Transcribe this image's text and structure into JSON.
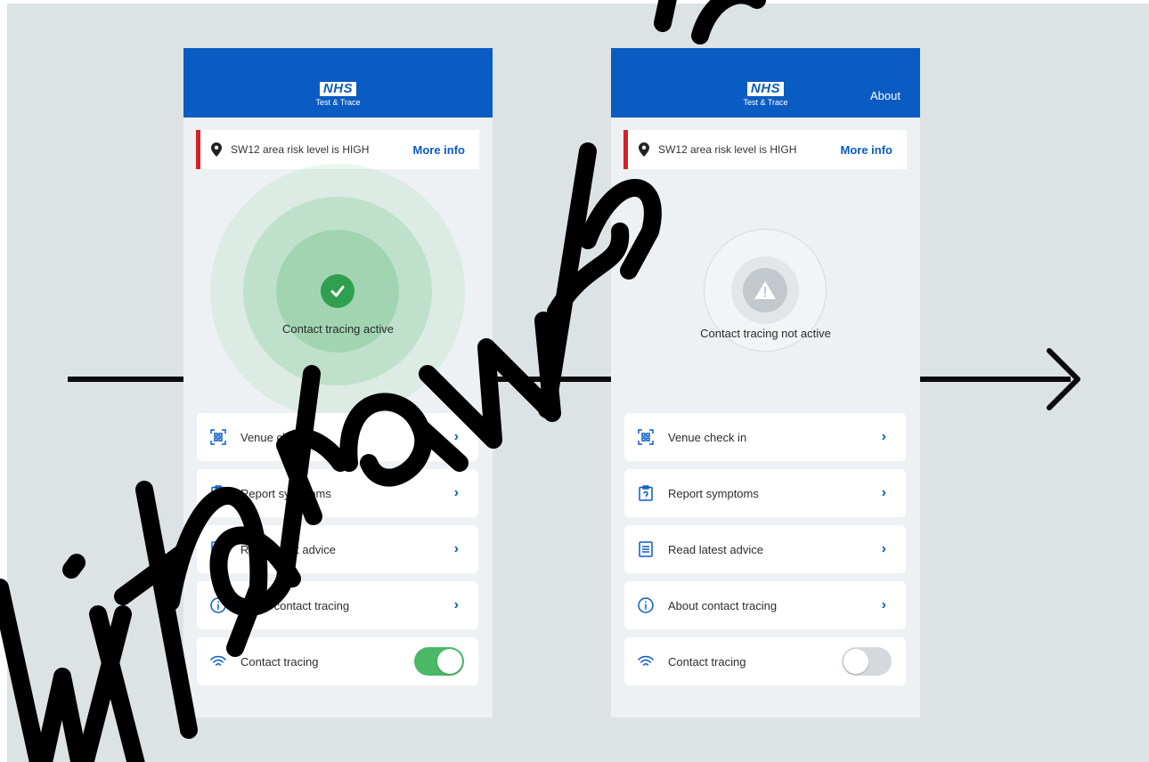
{
  "phones": [
    {
      "header": {
        "logo_mark": "NHS",
        "logo_subtitle": "Test & Trace",
        "about_label": ""
      },
      "risk_banner": {
        "text": "SW12 area risk level is HIGH",
        "link": "More info",
        "accent_color": "#d42228"
      },
      "status": {
        "text": "Contact tracing active",
        "state": "active",
        "color": "#2fa04f"
      },
      "menu": [
        {
          "label": "Venue check in",
          "icon": "qr-code-icon"
        },
        {
          "label": "Report symptoms",
          "icon": "clipboard-icon"
        },
        {
          "label": "Read latest advice",
          "icon": "document-icon"
        },
        {
          "label": "About contact tracing",
          "icon": "info-icon"
        }
      ],
      "toggle_row": {
        "label": "Contact tracing",
        "icon": "wifi-icon",
        "on": true
      }
    },
    {
      "header": {
        "logo_mark": "NHS",
        "logo_subtitle": "Test & Trace",
        "about_label": "About"
      },
      "risk_banner": {
        "text": "SW12 area risk level is HIGH",
        "link": "More info",
        "accent_color": "#d42228"
      },
      "status": {
        "text": "Contact tracing not active",
        "state": "inactive",
        "color": "#c3c8cc"
      },
      "menu": [
        {
          "label": "Venue check in",
          "icon": "qr-code-icon"
        },
        {
          "label": "Report symptoms",
          "icon": "clipboard-icon"
        },
        {
          "label": "Read latest advice",
          "icon": "document-icon"
        },
        {
          "label": "About contact tracing",
          "icon": "info-icon"
        }
      ],
      "toggle_row": {
        "label": "Contact tracing",
        "icon": "wifi-icon",
        "on": false
      }
    }
  ],
  "colors": {
    "brand_blue": "#0a5cc2",
    "toggle_on": "#4bb868",
    "background": "#dde2e5"
  }
}
